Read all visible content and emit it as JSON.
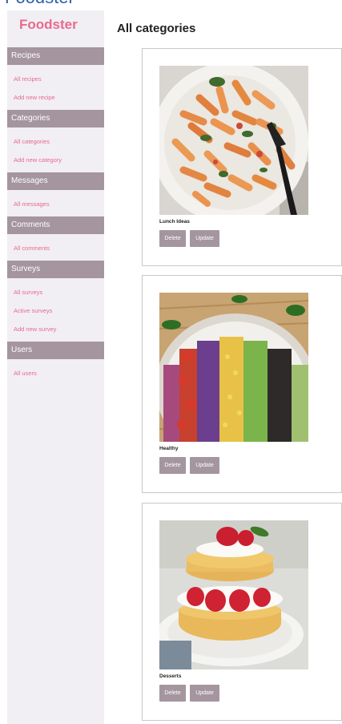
{
  "app": {
    "brand": "Foodster",
    "cut_header": "Foodster"
  },
  "sidebar": {
    "sections": [
      {
        "title": "Recipes",
        "links": [
          "All recipes",
          "Add new recipe"
        ]
      },
      {
        "title": "Categories",
        "links": [
          "All categories",
          "Add new category"
        ]
      },
      {
        "title": "Messages",
        "links": [
          "All messages"
        ]
      },
      {
        "title": "Comments",
        "links": [
          "All comments"
        ]
      },
      {
        "title": "Surveys",
        "links": [
          "All surveys",
          "Active surveys",
          "Add new survey"
        ]
      },
      {
        "title": "Users",
        "links": [
          "All users"
        ]
      }
    ]
  },
  "main": {
    "title": "All categories",
    "cards": [
      {
        "name": "Lunch Ideas",
        "image": "pasta-image",
        "delete_label": "Delete",
        "update_label": "Update"
      },
      {
        "name": "Healthy",
        "image": "salad-image",
        "delete_label": "Delete",
        "update_label": "Update"
      },
      {
        "name": "Desserts",
        "image": "shortcake-image",
        "delete_label": "Delete",
        "update_label": "Update"
      }
    ]
  },
  "colors": {
    "accent": "#e86a8e",
    "section_bg": "#a4959f",
    "sidebar_bg": "#f1eff3",
    "button_bg": "#a4959f"
  }
}
